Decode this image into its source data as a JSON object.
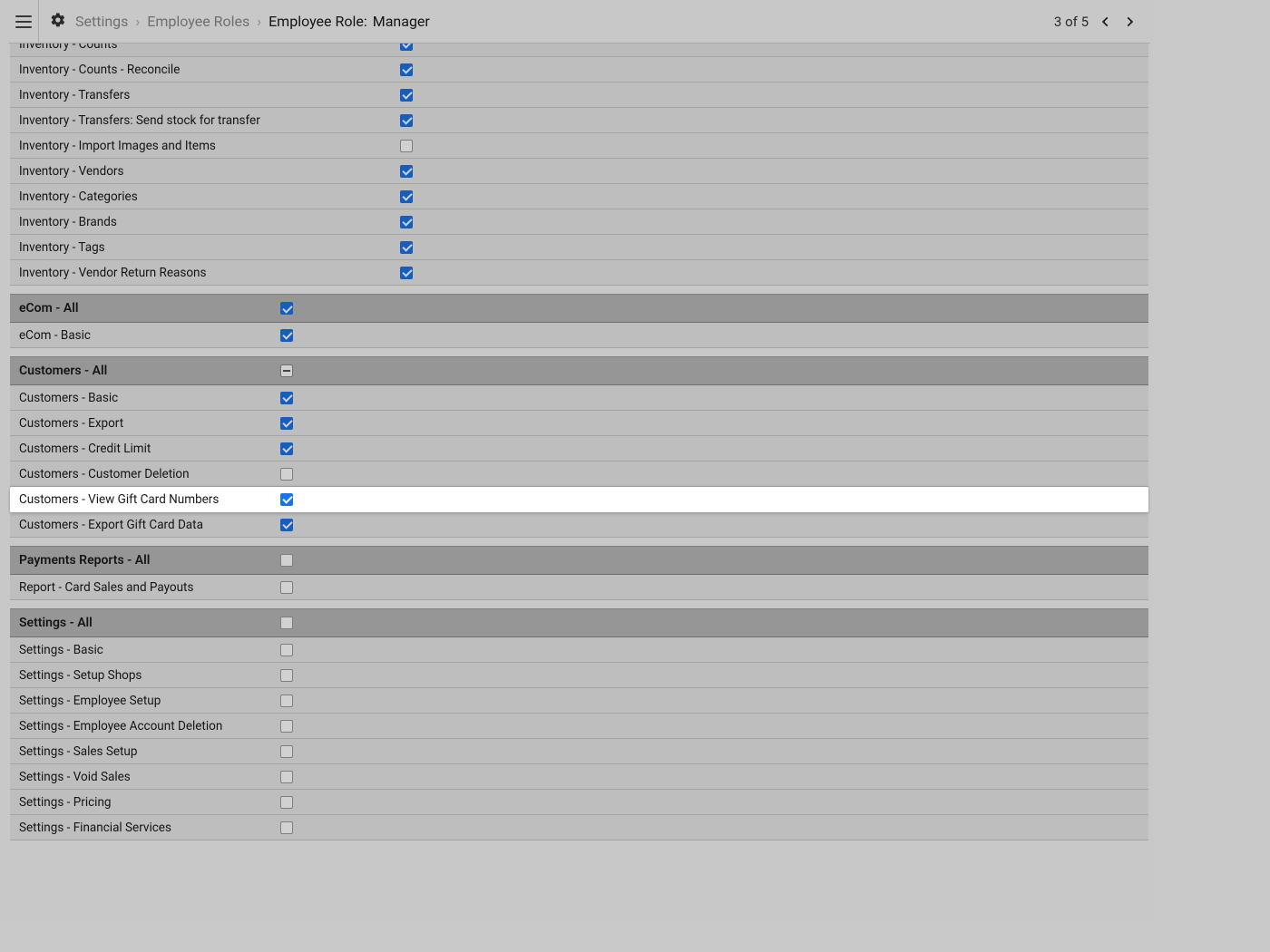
{
  "header": {
    "breadcrumb": {
      "settings": "Settings",
      "employee_roles": "Employee Roles",
      "current_prefix": "Employee Role:",
      "current_value": "Manager"
    },
    "counter": "3 of 5"
  },
  "groups": [
    {
      "id": "inventory",
      "partial_top_row": {
        "label": "Inventory - Counts",
        "checked": true
      },
      "checkbox_col": 2,
      "items": [
        {
          "label": "Inventory - Counts - Reconcile",
          "checked": true
        },
        {
          "label": "Inventory - Transfers",
          "checked": true
        },
        {
          "label": "Inventory - Transfers: Send stock for transfer",
          "checked": true
        },
        {
          "label": "Inventory - Import Images and Items",
          "checked": false
        },
        {
          "label": "Inventory - Vendors",
          "checked": true
        },
        {
          "label": "Inventory - Categories",
          "checked": true
        },
        {
          "label": "Inventory - Brands",
          "checked": true
        },
        {
          "label": "Inventory - Tags",
          "checked": true
        },
        {
          "label": "Inventory - Vendor Return Reasons",
          "checked": true
        }
      ]
    },
    {
      "id": "ecom",
      "header": {
        "label": "eCom - All",
        "state": "checked"
      },
      "checkbox_col": 1,
      "items": [
        {
          "label": "eCom - Basic",
          "checked": true
        }
      ]
    },
    {
      "id": "customers",
      "header": {
        "label": "Customers - All",
        "state": "indeterminate"
      },
      "checkbox_col": 1,
      "items": [
        {
          "label": "Customers - Basic",
          "checked": true
        },
        {
          "label": "Customers - Export",
          "checked": true
        },
        {
          "label": "Customers - Credit Limit",
          "checked": true
        },
        {
          "label": "Customers - Customer Deletion",
          "checked": false
        },
        {
          "label": "Customers - View Gift Card Numbers",
          "checked": true,
          "highlighted": true
        },
        {
          "label": "Customers - Export Gift Card Data",
          "checked": true
        }
      ]
    },
    {
      "id": "payments",
      "header": {
        "label": "Payments Reports - All",
        "state": "unchecked"
      },
      "checkbox_col": 1,
      "items": [
        {
          "label": "Report - Card Sales and Payouts",
          "checked": false
        }
      ]
    },
    {
      "id": "settings",
      "header": {
        "label": "Settings - All",
        "state": "unchecked"
      },
      "checkbox_col": 1,
      "items": [
        {
          "label": "Settings - Basic",
          "checked": false
        },
        {
          "label": "Settings - Setup Shops",
          "checked": false
        },
        {
          "label": "Settings - Employee Setup",
          "checked": false
        },
        {
          "label": "Settings - Employee Account Deletion",
          "checked": false
        },
        {
          "label": "Settings - Sales Setup",
          "checked": false
        },
        {
          "label": "Settings - Void Sales",
          "checked": false
        },
        {
          "label": "Settings - Pricing",
          "checked": false
        },
        {
          "label": "Settings - Financial Services",
          "checked": false
        }
      ]
    }
  ]
}
